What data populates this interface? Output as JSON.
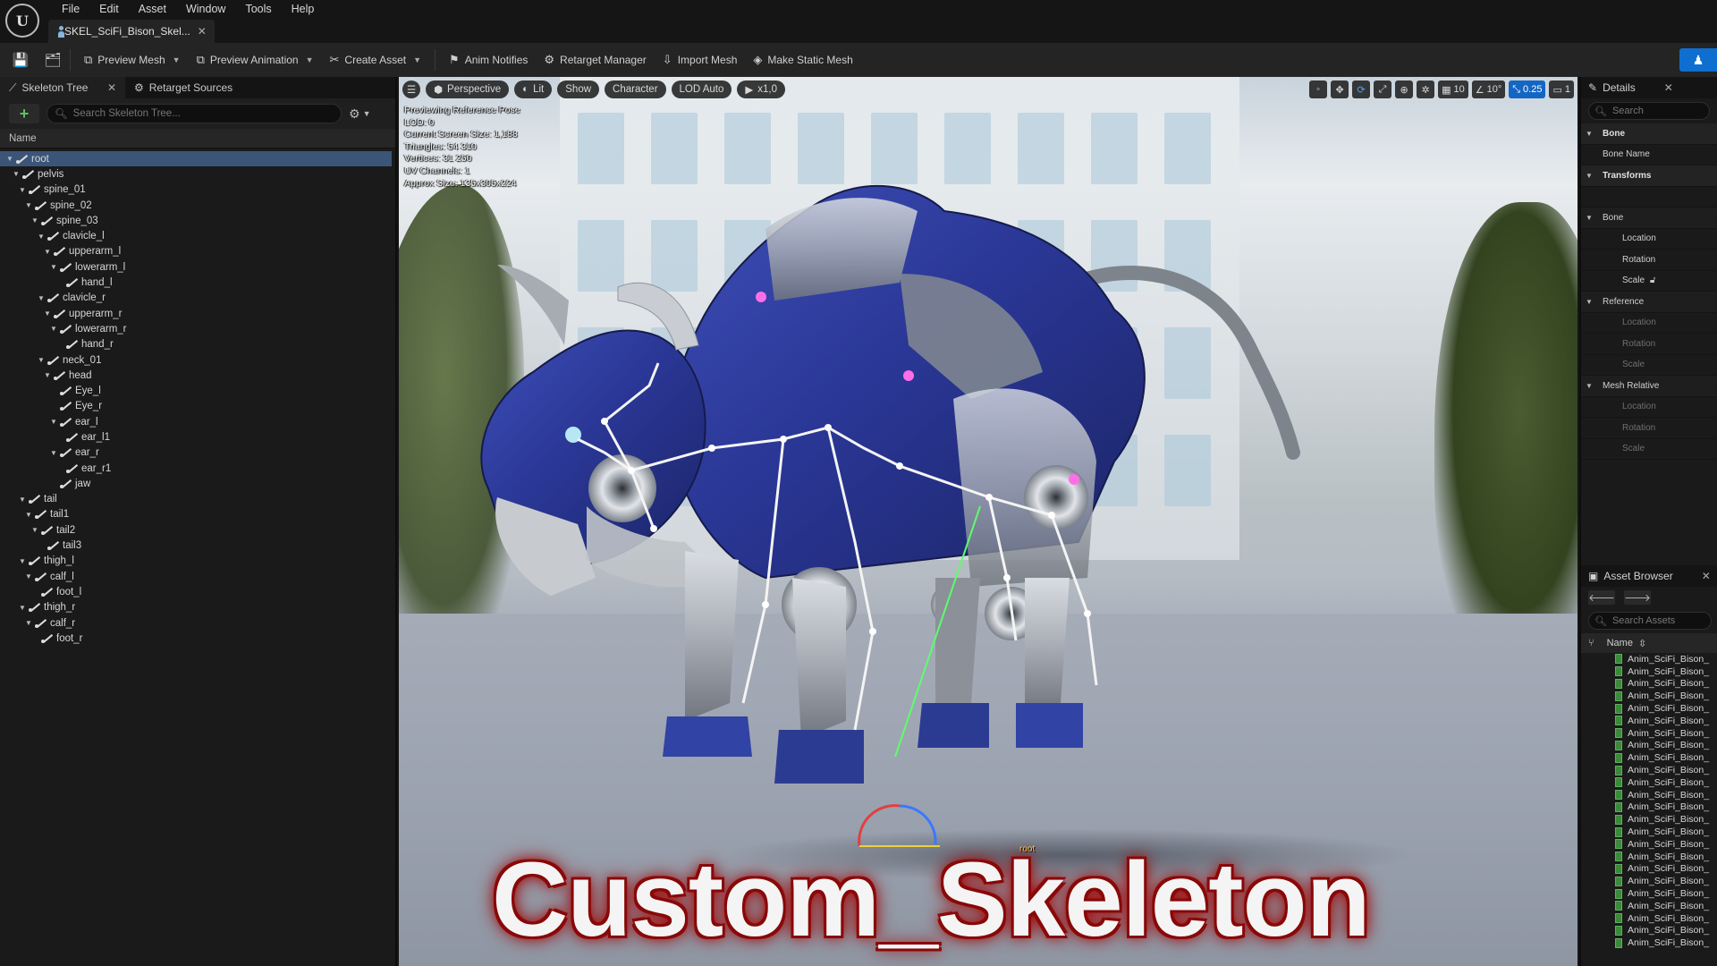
{
  "menubar": {
    "items": [
      "File",
      "Edit",
      "Asset",
      "Window",
      "Tools",
      "Help"
    ],
    "document_tab": "SKEL_SciFi_Bison_Skel...",
    "logo": "unreal-logo"
  },
  "toolbar": {
    "preview_mesh": "Preview Mesh",
    "preview_animation": "Preview Animation",
    "create_asset": "Create Asset",
    "anim_notifies": "Anim Notifies",
    "retarget_manager": "Retarget Manager",
    "import_mesh": "Import Mesh",
    "make_static_mesh": "Make Static Mesh"
  },
  "left_panel": {
    "tab_skeleton_tree": "Skeleton Tree",
    "tab_retarget_sources": "Retarget Sources",
    "search_placeholder": "Search Skeleton Tree...",
    "column_name": "Name",
    "bones": [
      {
        "name": "root",
        "depth": 0,
        "expanded": true,
        "selected": true
      },
      {
        "name": "pelvis",
        "depth": 1,
        "expanded": true
      },
      {
        "name": "spine_01",
        "depth": 2,
        "expanded": true
      },
      {
        "name": "spine_02",
        "depth": 3,
        "expanded": true
      },
      {
        "name": "spine_03",
        "depth": 4,
        "expanded": true
      },
      {
        "name": "clavicle_l",
        "depth": 5,
        "expanded": true
      },
      {
        "name": "upperarm_l",
        "depth": 6,
        "expanded": true
      },
      {
        "name": "lowerarm_l",
        "depth": 7,
        "expanded": true
      },
      {
        "name": "hand_l",
        "depth": 8
      },
      {
        "name": "clavicle_r",
        "depth": 5,
        "expanded": true
      },
      {
        "name": "upperarm_r",
        "depth": 6,
        "expanded": true
      },
      {
        "name": "lowerarm_r",
        "depth": 7,
        "expanded": true
      },
      {
        "name": "hand_r",
        "depth": 8
      },
      {
        "name": "neck_01",
        "depth": 5,
        "expanded": true
      },
      {
        "name": "head",
        "depth": 6,
        "expanded": true
      },
      {
        "name": "Eye_l",
        "depth": 7
      },
      {
        "name": "Eye_r",
        "depth": 7
      },
      {
        "name": "ear_l",
        "depth": 7,
        "expanded": true
      },
      {
        "name": "ear_l1",
        "depth": 8
      },
      {
        "name": "ear_r",
        "depth": 7,
        "expanded": true
      },
      {
        "name": "ear_r1",
        "depth": 8
      },
      {
        "name": "jaw",
        "depth": 7
      },
      {
        "name": "tail",
        "depth": 2,
        "expanded": true
      },
      {
        "name": "tail1",
        "depth": 3,
        "expanded": true
      },
      {
        "name": "tail2",
        "depth": 4,
        "expanded": true
      },
      {
        "name": "tail3",
        "depth": 5
      },
      {
        "name": "thigh_l",
        "depth": 2,
        "expanded": true
      },
      {
        "name": "calf_l",
        "depth": 3,
        "expanded": true
      },
      {
        "name": "foot_l",
        "depth": 4
      },
      {
        "name": "thigh_r",
        "depth": 2,
        "expanded": true
      },
      {
        "name": "calf_r",
        "depth": 3,
        "expanded": true
      },
      {
        "name": "foot_r",
        "depth": 4
      }
    ]
  },
  "viewport": {
    "perspective": "Perspective",
    "lit": "Lit",
    "show": "Show",
    "character": "Character",
    "lod": "LOD Auto",
    "play_speed": "x1,0",
    "grid_snap": "10",
    "rotation_snap": "10°",
    "scale_snap": "0.25",
    "camera_speed": "1",
    "stats": [
      "Previewing Reference Pose",
      "LOD: 0",
      "Current Screen Size: 1,188",
      "Triangles: 54 310",
      "Vertices: 31 250",
      "UV Channels: 1",
      "Approx Size: 135x305x224"
    ],
    "root_label": "root",
    "overlay_title": "Custom_Skeleton"
  },
  "details": {
    "tab": "Details",
    "search_placeholder": "Search",
    "rows": [
      {
        "label": "Bone",
        "kind": "cat"
      },
      {
        "label": "Bone Name",
        "kind": "prop"
      },
      {
        "label": "Transforms",
        "kind": "cat"
      },
      {
        "label": "",
        "kind": "gap"
      },
      {
        "label": "Bone",
        "kind": "sub"
      },
      {
        "label": "Location",
        "kind": "indent"
      },
      {
        "label": "Rotation",
        "kind": "indent"
      },
      {
        "label": "Scale",
        "kind": "indent-lock"
      },
      {
        "label": "Reference",
        "kind": "sub"
      },
      {
        "label": "Location",
        "kind": "indent-dim"
      },
      {
        "label": "Rotation",
        "kind": "indent-dim"
      },
      {
        "label": "Scale",
        "kind": "indent-dim"
      },
      {
        "label": "Mesh Relative",
        "kind": "sub"
      },
      {
        "label": "Location",
        "kind": "indent-dim"
      },
      {
        "label": "Rotation",
        "kind": "indent-dim"
      },
      {
        "label": "Scale",
        "kind": "indent-dim"
      }
    ]
  },
  "asset_browser": {
    "tab": "Asset Browser",
    "search_placeholder": "Search Assets",
    "column_name": "Name",
    "items": [
      "Anim_SciFi_Bison_",
      "Anim_SciFi_Bison_",
      "Anim_SciFi_Bison_",
      "Anim_SciFi_Bison_",
      "Anim_SciFi_Bison_",
      "Anim_SciFi_Bison_",
      "Anim_SciFi_Bison_",
      "Anim_SciFi_Bison_",
      "Anim_SciFi_Bison_",
      "Anim_SciFi_Bison_",
      "Anim_SciFi_Bison_",
      "Anim_SciFi_Bison_",
      "Anim_SciFi_Bison_",
      "Anim_SciFi_Bison_",
      "Anim_SciFi_Bison_",
      "Anim_SciFi_Bison_",
      "Anim_SciFi_Bison_",
      "Anim_SciFi_Bison_",
      "Anim_SciFi_Bison_",
      "Anim_SciFi_Bison_",
      "Anim_SciFi_Bison_",
      "Anim_SciFi_Bison_",
      "Anim_SciFi_Bison_",
      "Anim_SciFi_Bison_"
    ]
  },
  "colors": {
    "accent": "#0e6fd0",
    "selection": "#3b5578",
    "add_green": "#5cc25c",
    "title_outline": "#8c0a0a"
  }
}
